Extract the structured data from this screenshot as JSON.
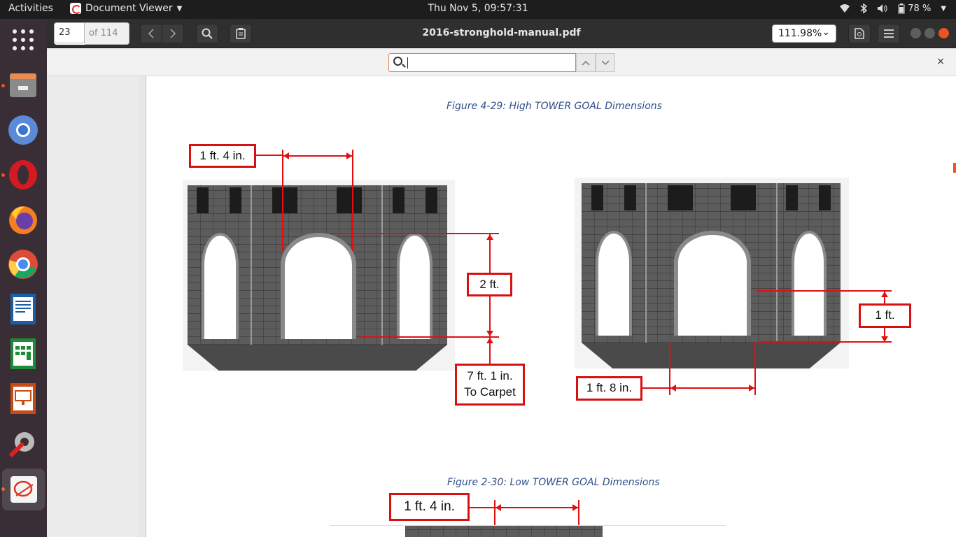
{
  "topbar": {
    "activities": "Activities",
    "app_name": "Document Viewer",
    "clock": "Thu Nov  5, 09:57:31",
    "battery": "78 %"
  },
  "dock": {
    "items": [
      "Show Applications",
      "Files",
      "Chromium",
      "Opera",
      "Firefox",
      "Chrome",
      "LibreOffice Writer",
      "LibreOffice Calc",
      "LibreOffice Impress",
      "System Tools",
      "Document Viewer"
    ]
  },
  "header": {
    "page_number": "23",
    "page_total": "of 114",
    "title": "2016-stronghold-manual.pdf",
    "zoom": "111.98%"
  },
  "findbar": {
    "query": ""
  },
  "document": {
    "figure1_caption": "Figure 4-29: High TOWER GOAL Dimensions",
    "figure2_caption": "Figure 2-30: Low TOWER GOAL Dimensions",
    "labels": {
      "w1": "1 ft. 4 in.",
      "h2ft": "2 ft.",
      "carpet_line1": "7 ft. 1 in.",
      "carpet_line2": "To Carpet",
      "h1ft": "1 ft.",
      "w18": "1 ft. 8 in.",
      "low_w": "1 ft. 4 in."
    }
  },
  "colors": {
    "accent": "#e95420",
    "dimension_red": "#e01010",
    "caption_blue": "#2f4f88"
  }
}
